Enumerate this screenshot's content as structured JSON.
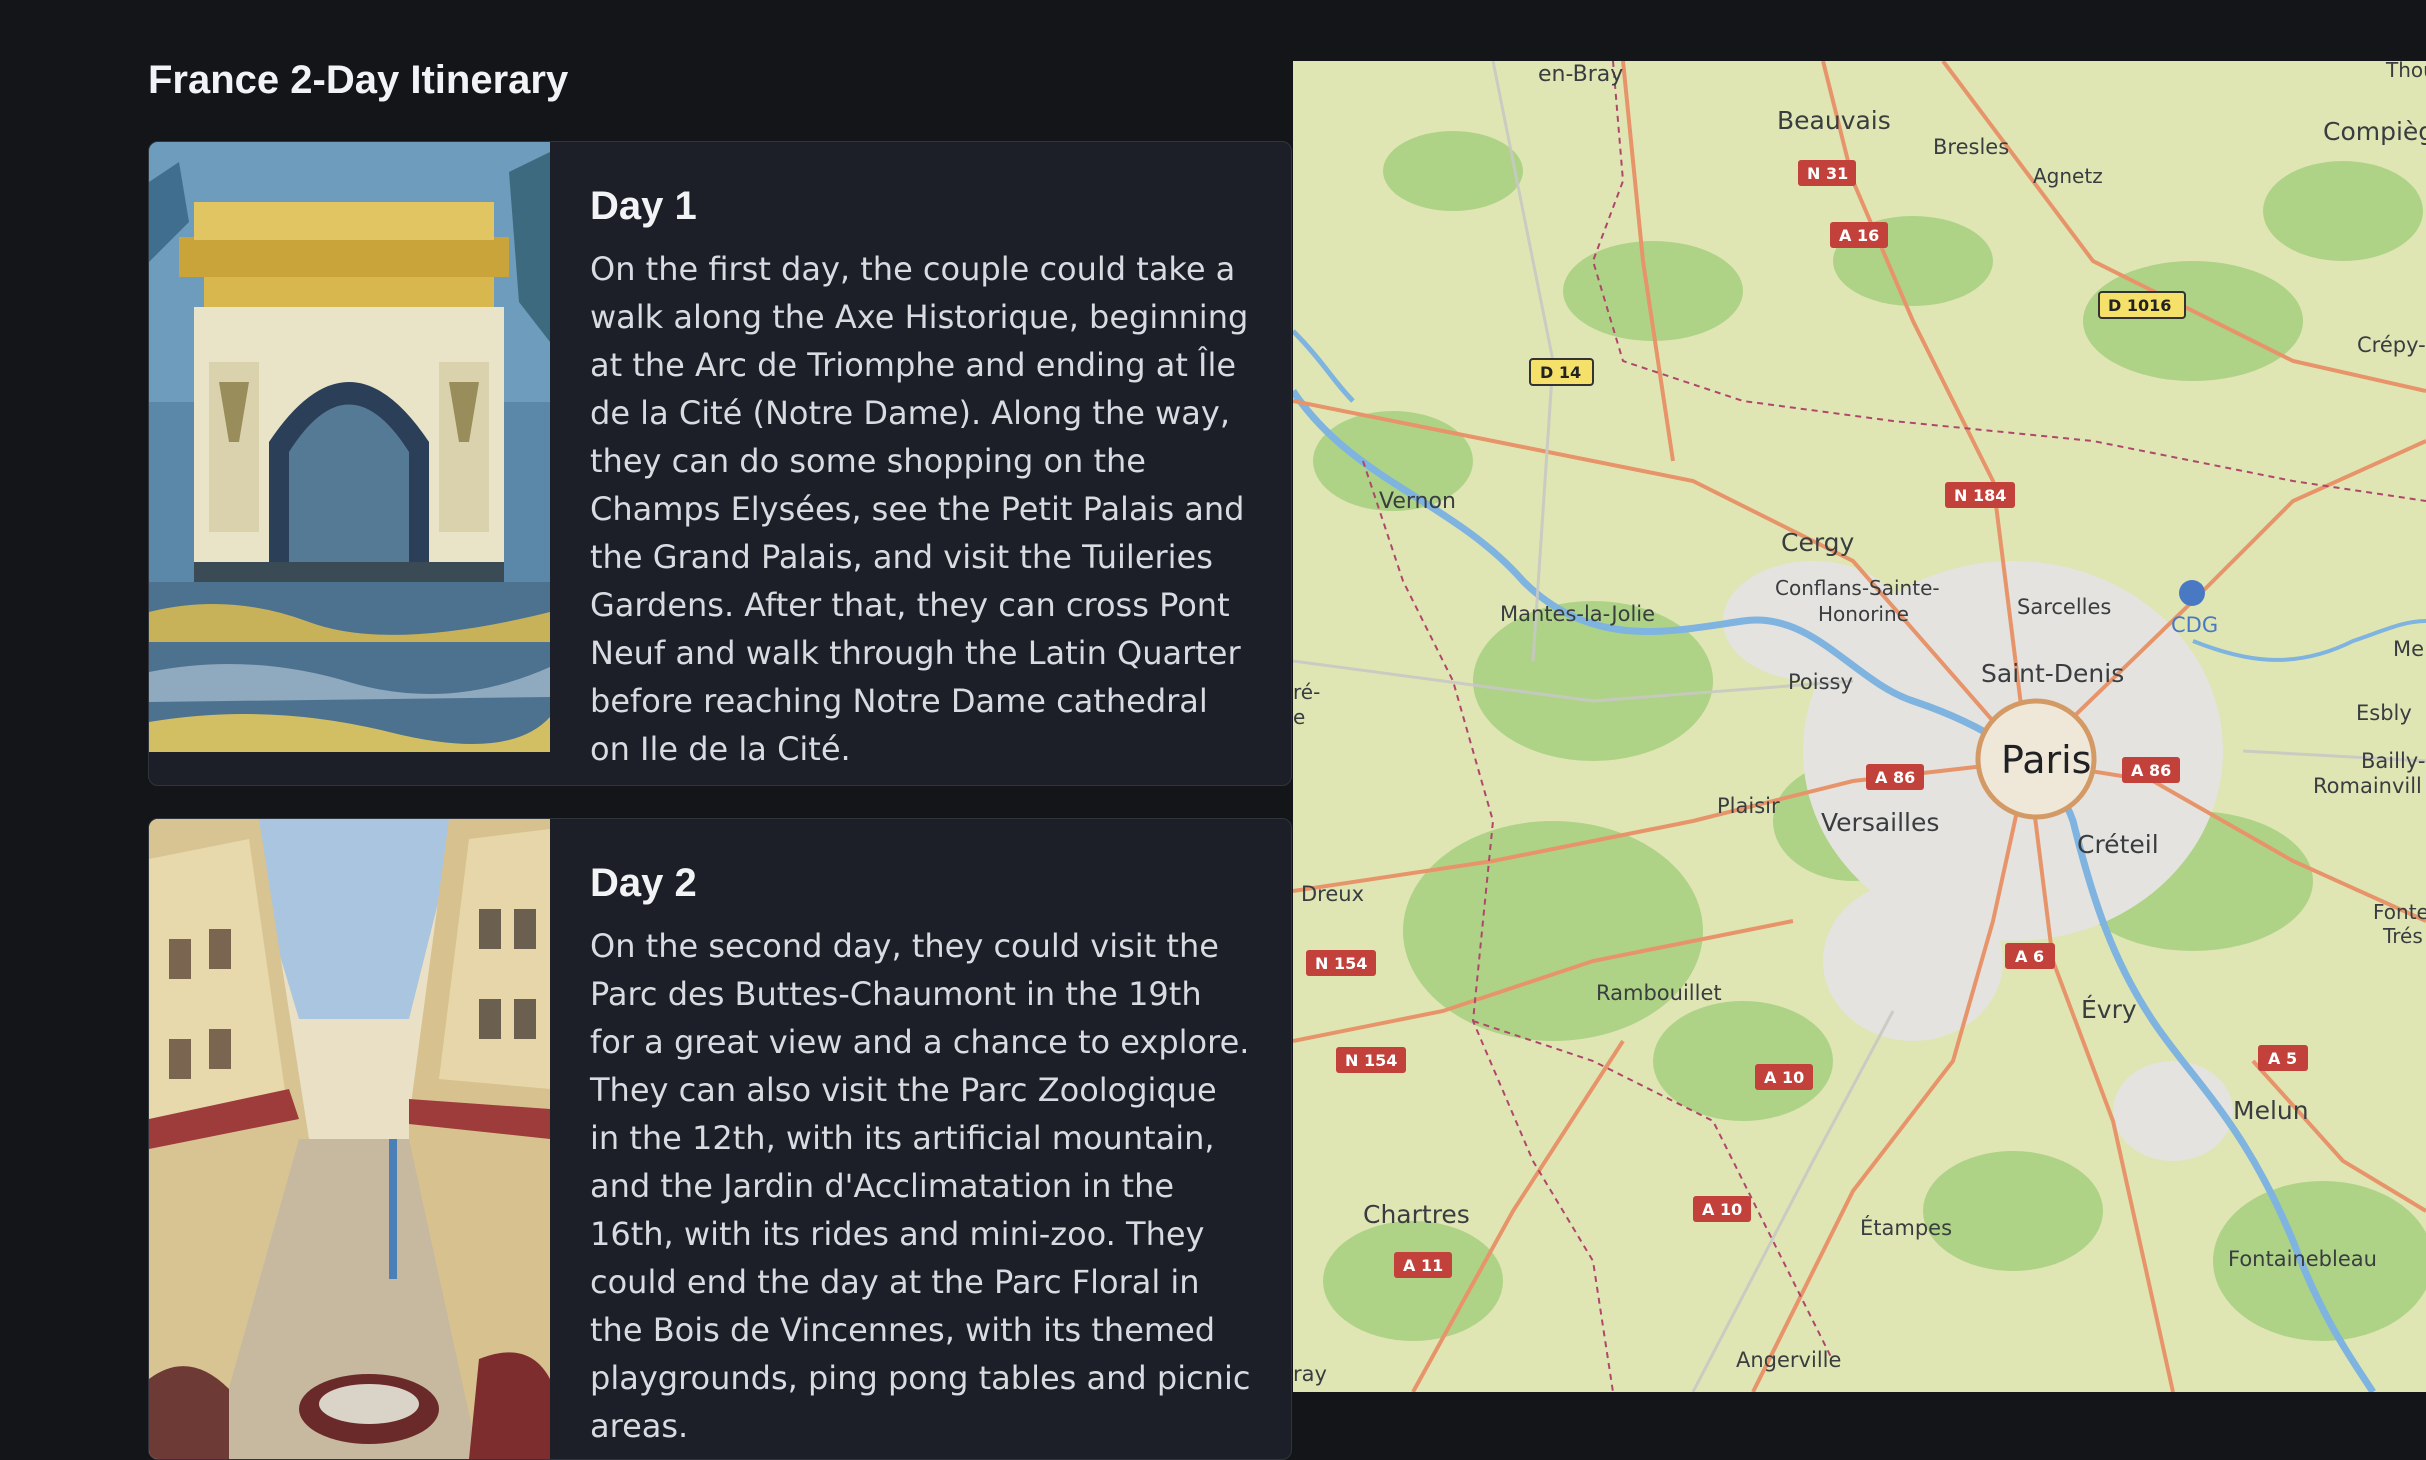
{
  "page": {
    "title": "France 2-Day Itinerary"
  },
  "days": [
    {
      "title": "Day 1",
      "text": "On the first day, the couple could take a walk along the Axe Historique, beginning at the Arc de Triomphe and ending at Île de la Cité (Notre Dame). Along the way, they can do some shopping on the Champs Elysées, see the Petit Palais and the Grand Palais, and visit the Tuileries Gardens. After that, they can cross Pont Neuf and walk through the Latin Quarter before reaching Notre Dame cathedral on Ile de la Cité.",
      "image": "arc-de-triomphe-painting"
    },
    {
      "title": "Day 2",
      "text": "On the second day, they could visit the Parc des Buttes-Chaumont in the 19th for a great view and a chance to explore. They can also visit the Parc Zoologique in the 12th, with its artificial mountain, and the Jardin d'Acclimatation in the 16th, with its rides and mini-zoo. They could end the day at the Parc Floral in the Bois de Vincennes, with its themed playgrounds, ping pong tables and picnic areas.",
      "image": "paris-street-sketch"
    }
  ],
  "map": {
    "places": {
      "en_bray": "en-Bray",
      "beauvais": "Beauvais",
      "bresles": "Bresles",
      "agnetz": "Agnetz",
      "compiegne": "Compièg",
      "thou": "Thou",
      "crepy": "Crépy-e",
      "vernon": "Vernon",
      "cergy": "Cergy",
      "conflans": "Conflans-Sainte-",
      "honorine": "Honorine",
      "sarcelles": "Sarcelles",
      "cdg": "CDG",
      "mantes": "Mantes-la-Jolie",
      "me": "Me",
      "poissy": "Poissy",
      "saint_denis": "Saint-Denis",
      "esbly": "Esbly",
      "bre": "ré-",
      "bre2": "e",
      "paris": "Paris",
      "bailly": "Bailly-",
      "romainvill": "Romainvill",
      "plaisir": "Plaisir",
      "versailles": "Versailles",
      "creteil": "Créteil",
      "dreux": "Dreux",
      "fonte": "Fonte",
      "tres": "Trés",
      "rambouillet": "Rambouillet",
      "evry": "Évry",
      "melun": "Melun",
      "chartres": "Chartres",
      "etampes": "Étampes",
      "fontainebleau": "Fontainebleau",
      "angerville": "Angerville",
      "ray": "ray"
    },
    "shields": {
      "n31": "N 31",
      "a16": "A 16",
      "d1016": "D 1016",
      "d14": "D 14",
      "n184": "N 184",
      "a86a": "A 86",
      "a86b": "A 86",
      "a6": "A 6",
      "n154a": "N 154",
      "n154b": "N 154",
      "a10a": "A 10",
      "a10b": "A 10",
      "a5": "A 5",
      "a11": "A 11"
    },
    "colors": {
      "land": "#dfe6b4",
      "forest": "#a6cf7e",
      "urban": "#e4e3df",
      "road": "#e8946a",
      "water": "#7fb3e0",
      "border": "#b0476b"
    }
  }
}
